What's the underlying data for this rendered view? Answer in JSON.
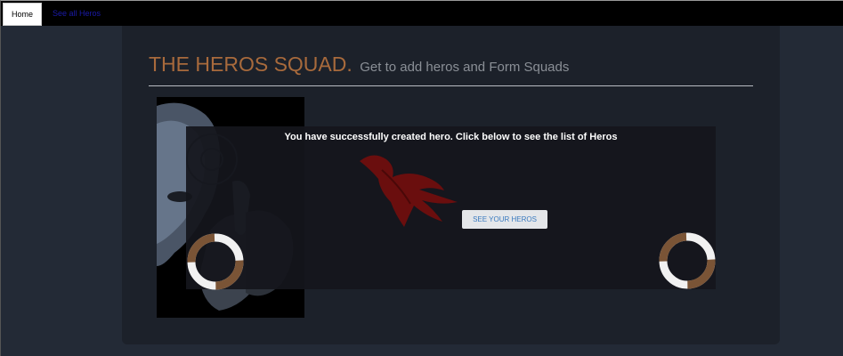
{
  "nav": {
    "home_label": "Home",
    "all_heros_label": "See all Heros"
  },
  "header": {
    "title": "THE HEROS SQUAD.",
    "subtitle": "Get to add heros and Form Squads"
  },
  "message": {
    "text": "You have successfully created hero. Click below to see the list of Heros",
    "button_label": "SEE YOUR HEROS"
  },
  "colors": {
    "background": "#232a36",
    "panel": "#1c212a",
    "title_accent": "#a86a3c",
    "ring_brown": "#7a5436",
    "ring_white": "#f1f1f1",
    "bird_red": "#6a0e0e"
  },
  "images": {
    "hero": "masked-hero-illustration",
    "bird": "phoenix-bird-logo",
    "spinner": "loading-ring-icon"
  }
}
